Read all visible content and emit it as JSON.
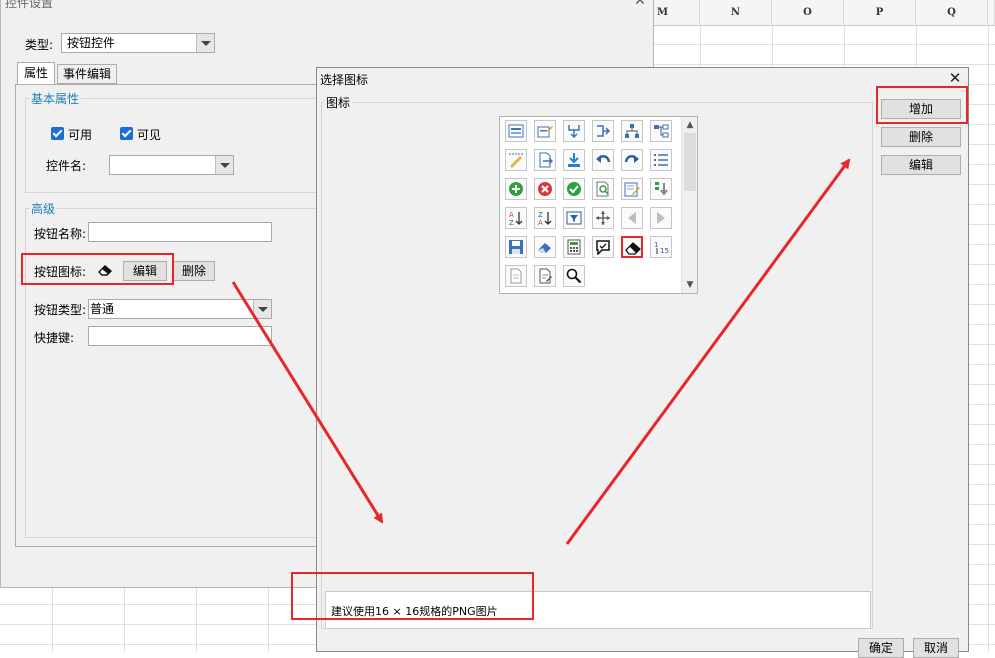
{
  "sheet": {
    "columns": [
      "M",
      "N",
      "O",
      "P",
      "Q"
    ]
  },
  "settings_dialog": {
    "title": "控件设置",
    "type_label": "类型:",
    "type_value": "按钮控件",
    "tabs": [
      {
        "label": "属性",
        "active": true
      },
      {
        "label": "事件编辑",
        "active": false
      }
    ],
    "basic_group": {
      "title": "基本属性",
      "enabled_label": "可用",
      "visible_label": "可见",
      "control_name_label": "控件名:",
      "control_name_value": ""
    },
    "advanced_group": {
      "title": "高级",
      "button_name_label": "按钮名称:",
      "button_name_value": "",
      "button_icon_label": "按钮图标:",
      "edit_button": "编辑",
      "delete_button": "删除",
      "button_type_label": "按钮类型:",
      "button_type_value": "普通",
      "shortcut_label": "快捷键:",
      "shortcut_value": ""
    }
  },
  "icon_dialog": {
    "title": "选择图标",
    "icons_group_title": "图标",
    "add_button": "增加",
    "delete_button": "删除",
    "edit_button": "编辑",
    "hint_text": "建议使用16 × 16规格的PNG图片",
    "ok_button": "确定",
    "cancel_button": "取消",
    "icons": [
      "form-icon",
      "edit-form-icon",
      "merge-down-icon",
      "branch-right-icon",
      "tree-structure-icon",
      "hierarchy-icon",
      "ruler-edit-icon",
      "export-page-icon",
      "import-icon",
      "undo-icon",
      "redo-icon",
      "list-icon",
      "add-circle-icon",
      "delete-circle-icon",
      "check-circle-icon",
      "search-page-icon",
      "edit-note-icon",
      "move-down-icon",
      "sort-az-icon",
      "sort-za-icon",
      "filter-icon",
      "move-arrows-icon",
      "previous-icon",
      "next-icon",
      "save-icon",
      "eraser-blue-icon",
      "calculator-icon",
      "comment-icon",
      "eraser-icon",
      "sort-numbers-icon",
      "document-grey-icon",
      "document-edit-icon",
      "magnifier-icon"
    ],
    "selected_icon": "eraser-icon",
    "colors": {
      "highlight": "#e8262a",
      "group_title": "#1c7fb9",
      "checkbox": "#1a6fd6"
    }
  }
}
